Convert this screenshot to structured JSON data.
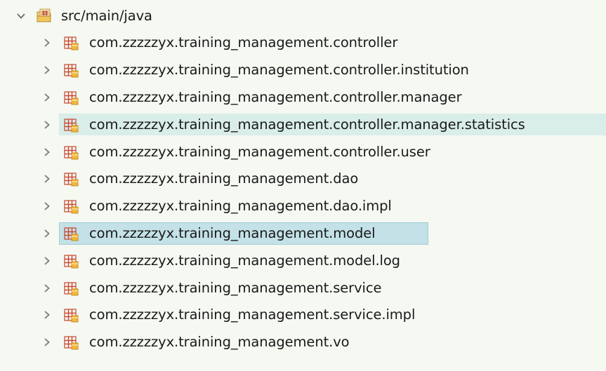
{
  "root": {
    "label": "src/main/java",
    "expanded": true,
    "icon": "source-folder-icon"
  },
  "packages": [
    {
      "label": "com.zzzzzyx.training_management.controller",
      "highlight": "none"
    },
    {
      "label": "com.zzzzzyx.training_management.controller.institution",
      "highlight": "none"
    },
    {
      "label": "com.zzzzzyx.training_management.controller.manager",
      "highlight": "none"
    },
    {
      "label": "com.zzzzzyx.training_management.controller.manager.statistics",
      "highlight": "hover"
    },
    {
      "label": "com.zzzzzyx.training_management.controller.user",
      "highlight": "none"
    },
    {
      "label": "com.zzzzzyx.training_management.dao",
      "highlight": "none"
    },
    {
      "label": "com.zzzzzyx.training_management.dao.impl",
      "highlight": "none"
    },
    {
      "label": "com.zzzzzyx.training_management.model",
      "highlight": "selected"
    },
    {
      "label": "com.zzzzzyx.training_management.model.log",
      "highlight": "none"
    },
    {
      "label": "com.zzzzzyx.training_management.service",
      "highlight": "none"
    },
    {
      "label": "com.zzzzzyx.training_management.service.impl",
      "highlight": "none"
    },
    {
      "label": "com.zzzzzyx.training_management.vo",
      "highlight": "none"
    }
  ],
  "colors": {
    "background": "#f5f9f2",
    "hover": "#d9ede9",
    "selected": "#c3e1e6",
    "chevron": "#7a7a7a",
    "package_icon": "#c0392b"
  }
}
